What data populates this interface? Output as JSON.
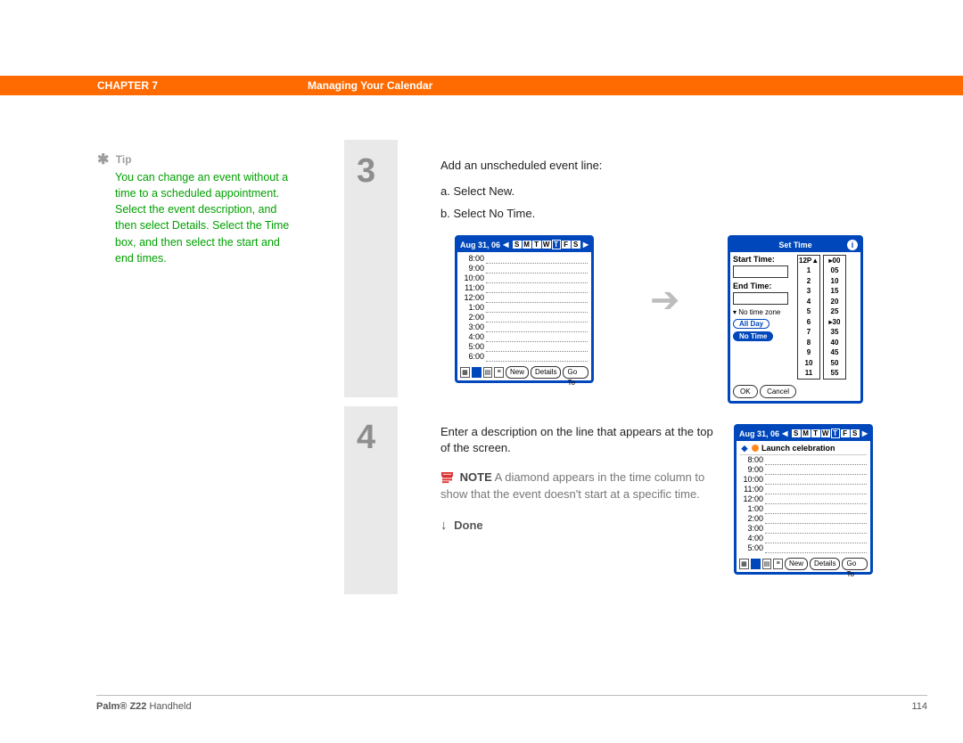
{
  "header": {
    "chapter": "CHAPTER 7",
    "title": "Managing Your Calendar"
  },
  "tip": {
    "label": "Tip",
    "body": "You can change an event without a time to a scheduled appointment. Select the event description, and then select Details. Select the Time box, and then select the start and end times."
  },
  "step3": {
    "num": "3",
    "line": "Add an unscheduled event line:",
    "a": "a.  Select New.",
    "b": "b.  Select No Time."
  },
  "step4": {
    "num": "4",
    "line": "Enter a description on the line that appears at the top of the screen.",
    "note_label": "NOTE",
    "note": " A diamond appears in the time column to show that the event doesn't start at a specific time.",
    "done": "Done"
  },
  "palm_day": {
    "date": "Aug 31, 06",
    "days": [
      "S",
      "M",
      "T",
      "W",
      "T",
      "F",
      "S"
    ],
    "selected_day_index": 4,
    "times": [
      "8:00",
      "9:00",
      "10:00",
      "11:00",
      "12:00",
      "1:00",
      "2:00",
      "3:00",
      "4:00",
      "5:00",
      "6:00"
    ],
    "buttons": {
      "new": "New",
      "details": "Details",
      "goto": "Go To"
    }
  },
  "palm_day2": {
    "date": "Aug 31, 06",
    "days": [
      "S",
      "M",
      "T",
      "W",
      "T",
      "F",
      "S"
    ],
    "selected_day_index": 4,
    "event": "Launch celebration",
    "times": [
      "8:00",
      "9:00",
      "10:00",
      "11:00",
      "12:00",
      "1:00",
      "2:00",
      "3:00",
      "4:00",
      "5:00"
    ],
    "buttons": {
      "new": "New",
      "details": "Details",
      "goto": "Go To"
    }
  },
  "set_time": {
    "title": "Set Time",
    "start": "Start Time:",
    "end": "End Time:",
    "notz": "No time zone",
    "allday": "All Day",
    "notime": "No Time",
    "ok": "OK",
    "cancel": "Cancel",
    "hours": [
      "12P▲",
      "1",
      "2",
      "3",
      "4",
      "5",
      "6",
      "7",
      "8",
      "9",
      "10",
      "11"
    ],
    "mins": [
      "▸00",
      "05",
      "10",
      "15",
      "20",
      "25",
      "▸30",
      "35",
      "40",
      "45",
      "50",
      "55"
    ]
  },
  "footer": {
    "product": "Palm® Z22 ",
    "suffix": "Handheld",
    "page": "114"
  }
}
